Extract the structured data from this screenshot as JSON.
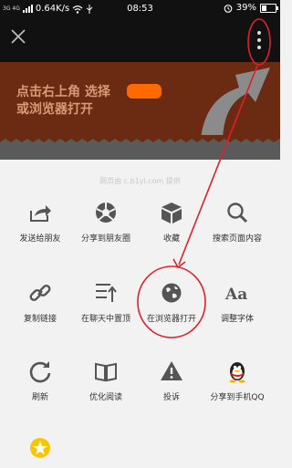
{
  "status_bar": {
    "signal_label": "3G 4G",
    "network_speed": "0.64K/s",
    "time": "08:53",
    "battery": "39%"
  },
  "banner": {
    "line1": "点击右上角 选择",
    "line2": "或浏览器打开"
  },
  "share_sheet": {
    "provided_by": "网页由 c.b1yl.com 提供",
    "items": [
      {
        "label": "发送给朋友",
        "icon": "share-arrow-icon"
      },
      {
        "label": "分享到朋友圈",
        "icon": "moments-aperture-icon"
      },
      {
        "label": "收藏",
        "icon": "favorite-cube-icon"
      },
      {
        "label": "搜索页面内容",
        "icon": "search-icon"
      },
      {
        "label": "复制链接",
        "icon": "link-icon"
      },
      {
        "label": "在聊天中置顶",
        "icon": "pin-top-icon"
      },
      {
        "label": "在浏览器打开",
        "icon": "globe-icon"
      },
      {
        "label": "调整字体",
        "icon": "font-size-icon"
      },
      {
        "label": "刷新",
        "icon": "refresh-icon"
      },
      {
        "label": "优化阅读",
        "icon": "reading-book-icon"
      },
      {
        "label": "投诉",
        "icon": "warning-icon"
      },
      {
        "label": "分享到手机QQ",
        "icon": "qq-penguin-icon"
      },
      {
        "label": "",
        "icon": "qzone-star-icon"
      }
    ]
  },
  "colors": {
    "status_bar_bg": "#111111",
    "banner_bg": "#6b2a12",
    "sheet_bg": "#f2f2f2",
    "annotation_red": "#e0202a"
  }
}
